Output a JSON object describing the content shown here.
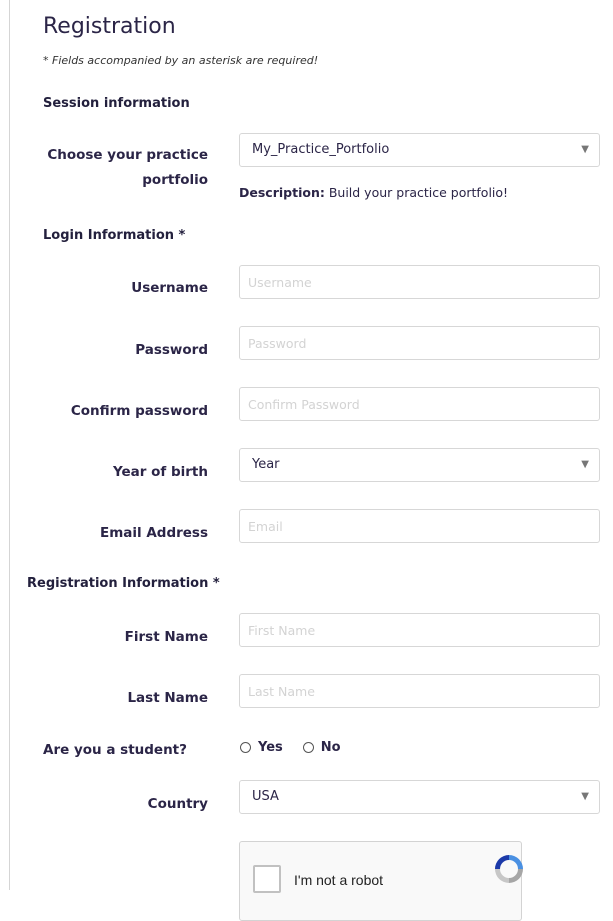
{
  "header": {
    "title": "Registration",
    "required_note": "* Fields accompanied by an asterisk are required!"
  },
  "session": {
    "heading": "Session information",
    "portfolio_label_line1": "Choose your practice",
    "portfolio_label_line2": "portfolio",
    "portfolio_value": "My_Practice_Portfolio",
    "description_label": "Description:",
    "description_text": " Build your practice portfolio!"
  },
  "login": {
    "heading": "Login Information *",
    "username_label": "Username",
    "username_placeholder": "Username",
    "password_label": "Password",
    "password_placeholder": "Password",
    "confirm_label": "Confirm password",
    "confirm_placeholder": "Confirm Password",
    "year_label": "Year of birth",
    "year_value": "Year",
    "email_label": "Email Address",
    "email_placeholder": "Email"
  },
  "registration": {
    "heading": "Registration Information *",
    "first_name_label": "First Name",
    "first_name_placeholder": "First Name",
    "last_name_label": "Last Name",
    "last_name_placeholder": "Last Name",
    "student_label": "Are you a student?",
    "student_yes": "Yes",
    "student_no": "No",
    "country_label": "Country",
    "country_value": "USA"
  },
  "captcha": {
    "label": "I'm not a robot"
  },
  "icons": {
    "dropdown": "chevron-down-icon",
    "captcha_logo": "recaptcha-icon"
  },
  "colors": {
    "text_dark": "#2b2547",
    "border": "#d7d7d7",
    "placeholder": "#d3d3d3"
  }
}
